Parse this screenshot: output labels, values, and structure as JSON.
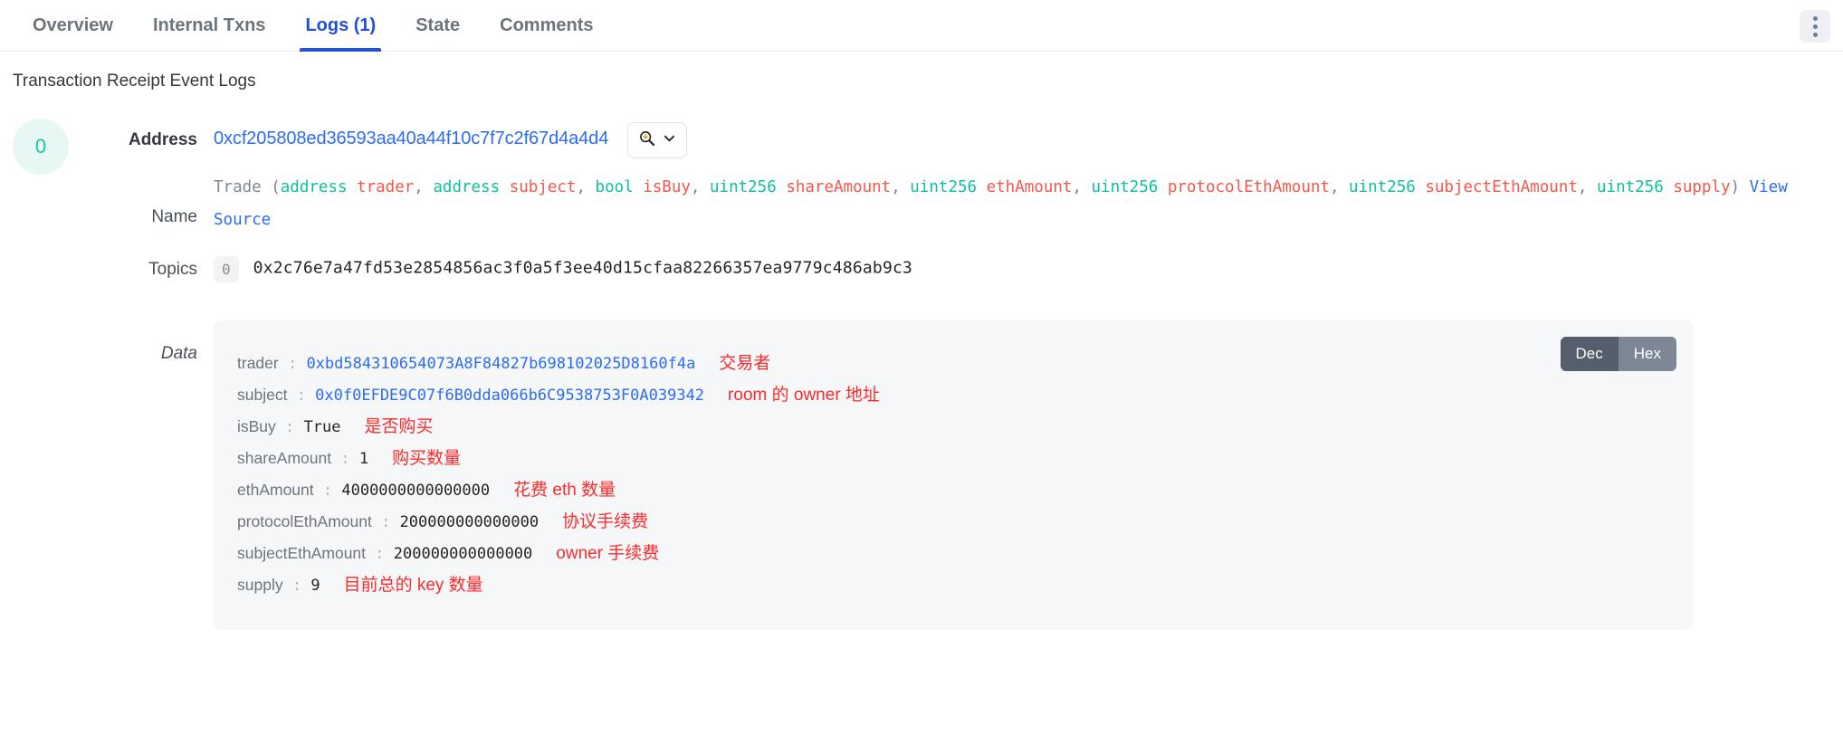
{
  "tabs": [
    {
      "label": "Overview",
      "active": false
    },
    {
      "label": "Internal Txns",
      "active": false
    },
    {
      "label": "Logs (1)",
      "active": true
    },
    {
      "label": "State",
      "active": false
    },
    {
      "label": "Comments",
      "active": false
    }
  ],
  "menu": {
    "icon": "kebab-vertical-icon"
  },
  "section": {
    "title": "Transaction Receipt Event Logs"
  },
  "log": {
    "index": "0",
    "labels": {
      "address": "Address",
      "name": "Name",
      "topics": "Topics",
      "data": "Data"
    },
    "address": {
      "value": "0xcf205808ed36593aa40a44f10c7f7c2f67d4a4d4",
      "zoom_button": {
        "icon": "magnifier-plus-icon",
        "caret": "chevron-down-icon"
      }
    },
    "signature": {
      "event": "Trade",
      "params": [
        {
          "type": "address",
          "name": "trader"
        },
        {
          "type": "address",
          "name": "subject"
        },
        {
          "type": "bool",
          "name": "isBuy"
        },
        {
          "type": "uint256",
          "name": "shareAmount"
        },
        {
          "type": "uint256",
          "name": "ethAmount"
        },
        {
          "type": "uint256",
          "name": "protocolEthAmount"
        },
        {
          "type": "uint256",
          "name": "subjectEthAmount"
        },
        {
          "type": "uint256",
          "name": "supply"
        }
      ],
      "view_source": "View Source"
    },
    "topics": [
      {
        "index": "0",
        "value": "0x2c76e7a47fd53e2854856ac3f0a5f3ee40d15cfaa82266357ea9779c486ab9c3"
      }
    ],
    "data": {
      "encoding_toggle": {
        "dec": "Dec",
        "hex": "Hex",
        "selected": "Dec"
      },
      "fields": [
        {
          "key": "trader",
          "value": "0xbd584310654073A8F84827b698102025D8160f4a",
          "is_address": true,
          "note": "交易者"
        },
        {
          "key": "subject",
          "value": "0x0f0EFDE9C07f6B0dda066b6C9538753F0A039342",
          "is_address": true,
          "note": "room 的 owner 地址"
        },
        {
          "key": "isBuy",
          "value": "True",
          "is_address": false,
          "note": "是否购买"
        },
        {
          "key": "shareAmount",
          "value": "1",
          "is_address": false,
          "note": "购买数量"
        },
        {
          "key": "ethAmount",
          "value": "4000000000000000",
          "is_address": false,
          "note": "花费 eth 数量"
        },
        {
          "key": "protocolEthAmount",
          "value": "200000000000000",
          "is_address": false,
          "note": "协议手续费"
        },
        {
          "key": "subjectEthAmount",
          "value": "200000000000000",
          "is_address": false,
          "note": "owner 手续费"
        },
        {
          "key": "supply",
          "value": "9",
          "is_address": false,
          "note": "目前总的 key 数量"
        }
      ]
    }
  },
  "colors": {
    "accent_blue": "#2b6cf5",
    "tab_active": "#1f4fe0",
    "type_teal": "#0fbf9f",
    "param_red": "#f4574b",
    "note_red": "#fc2b2b",
    "badge_teal": "#16c8a3",
    "panel_bg": "#f6f7f9"
  }
}
